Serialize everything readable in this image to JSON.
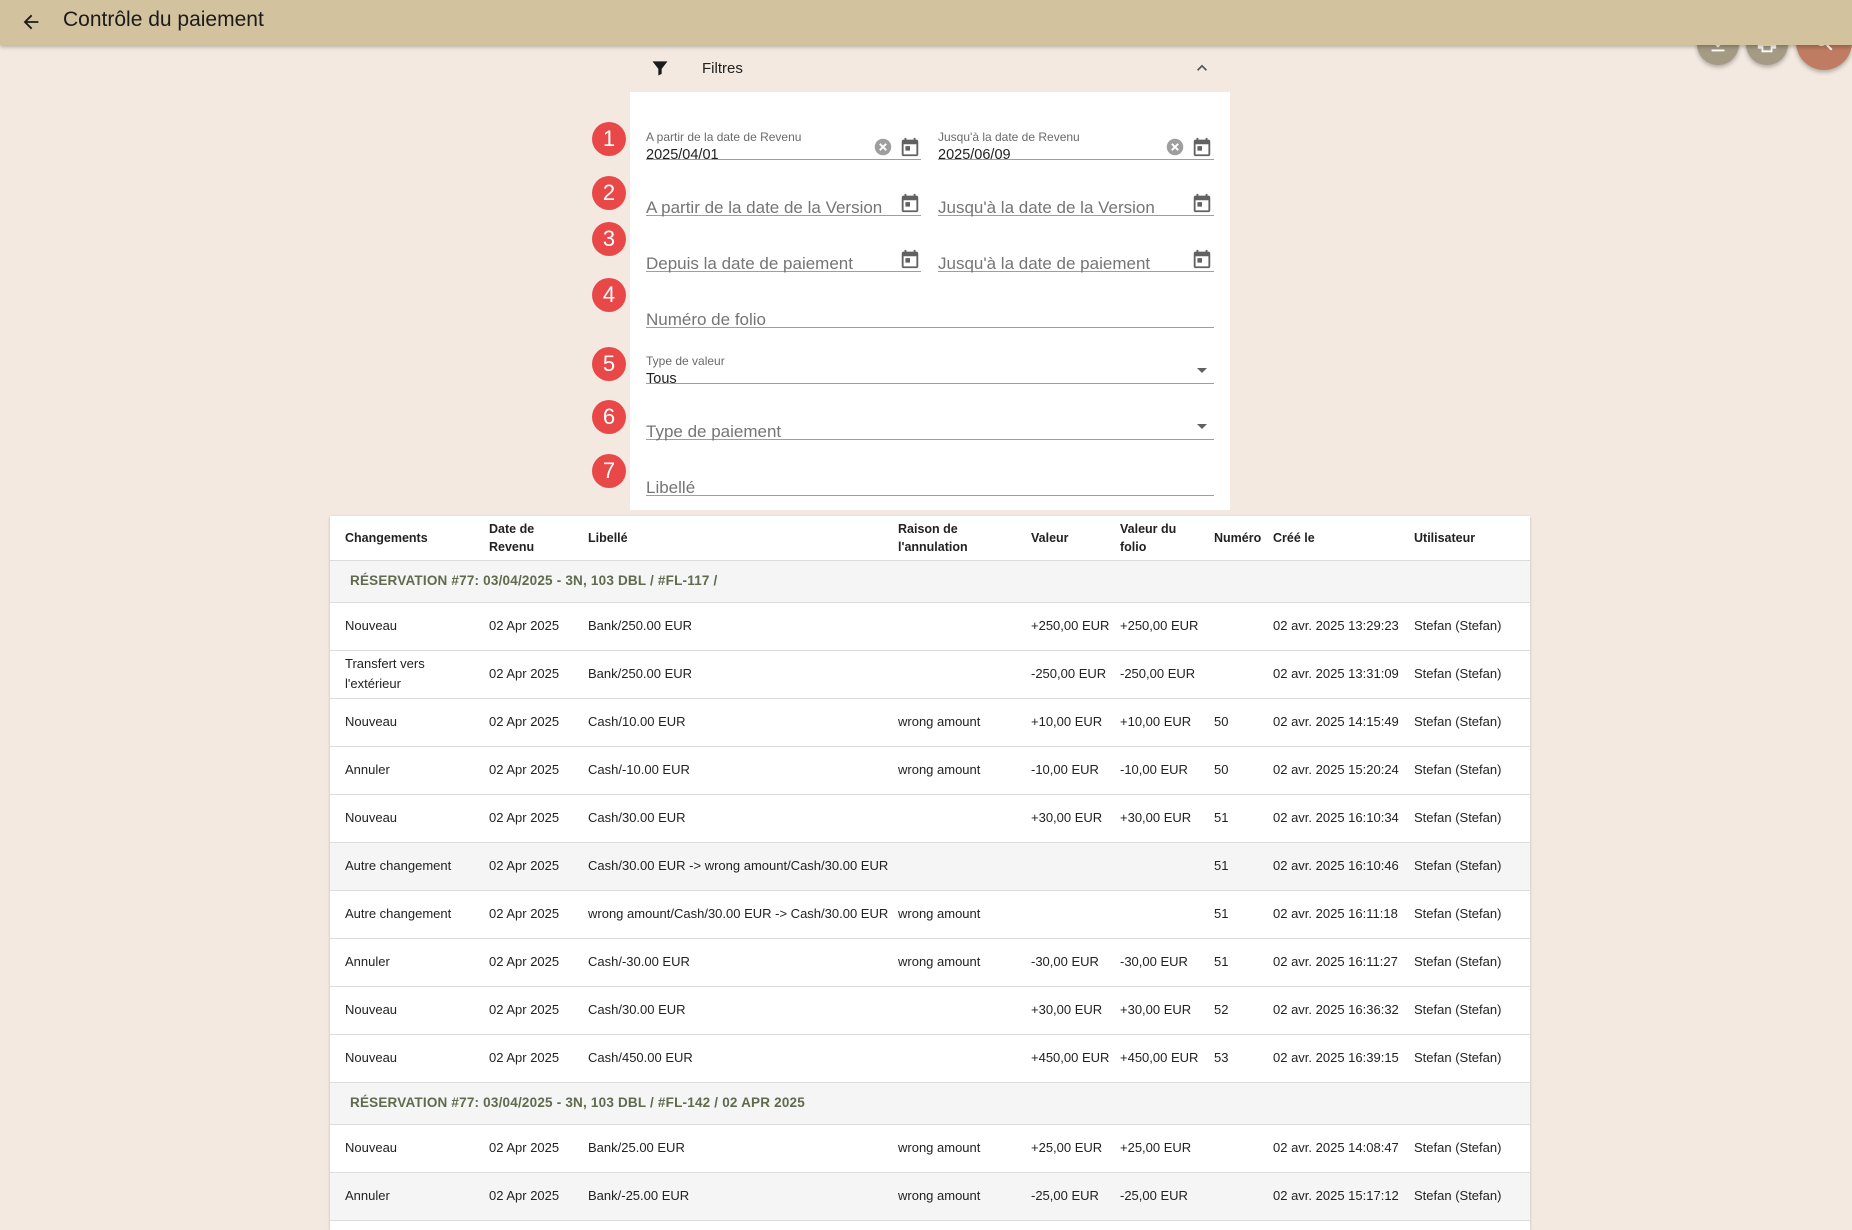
{
  "app": {
    "title": "Contrôle du paiement"
  },
  "filters": {
    "header_label": "Filtres",
    "revenue_from": {
      "label": "A partir de la date de Revenu",
      "value": "2025/04/01"
    },
    "revenue_to": {
      "label": "Jusqu'à la date de Revenu",
      "value": "2025/06/09"
    },
    "version_from_placeholder": "A partir de la date de la Version",
    "version_to_placeholder": "Jusqu'à la date de la Version",
    "payment_from_placeholder": "Depuis la date de paiement",
    "payment_to_placeholder": "Jusqu'à la date de paiement",
    "folio_placeholder": "Numéro de folio",
    "value_type": {
      "label": "Type de valeur",
      "value": "Tous"
    },
    "payment_type_placeholder": "Type de paiement",
    "libelle_placeholder": "Libellé"
  },
  "badges": [
    "1",
    "2",
    "3",
    "4",
    "5",
    "6",
    "7"
  ],
  "table": {
    "headers": {
      "changes": "Changements",
      "revenue_date_1": "Date de",
      "revenue_date_2": "Revenu",
      "libelle": "Libellé",
      "cancel_reason_1": "Raison de",
      "cancel_reason_2": "l'annulation",
      "value": "Valeur",
      "folio_value_1": "Valeur du",
      "folio_value_2": "folio",
      "number": "Numéro",
      "created": "Créé le",
      "user": "Utilisateur"
    },
    "rows": [
      {
        "type": "group",
        "text": "RÉSERVATION #77: 03/04/2025 - 3N, 103 DBL / #FL-117 /"
      },
      {
        "type": "row",
        "change": "Nouveau",
        "date": "02 Apr 2025",
        "libelle": "Bank/250.00 EUR",
        "reason": "",
        "value": "+250,00 EUR",
        "folio_value": "+250,00 EUR",
        "number": "",
        "created": "02 avr. 2025 13:29:23",
        "user": "Stefan (Stefan)",
        "shaded": false
      },
      {
        "type": "row",
        "change": "Transfert vers l'extérieur",
        "date": "02 Apr 2025",
        "libelle": "Bank/250.00 EUR",
        "reason": "",
        "value": "-250,00 EUR",
        "folio_value": "-250,00 EUR",
        "number": "",
        "created": "02 avr. 2025 13:31:09",
        "user": "Stefan (Stefan)",
        "shaded": false
      },
      {
        "type": "row",
        "change": "Nouveau",
        "date": "02 Apr 2025",
        "libelle": "Cash/10.00 EUR",
        "reason": "wrong amount",
        "value": "+10,00 EUR",
        "folio_value": "+10,00 EUR",
        "number": "50",
        "created": "02 avr. 2025 14:15:49",
        "user": "Stefan (Stefan)",
        "shaded": false
      },
      {
        "type": "row",
        "change": "Annuler",
        "date": "02 Apr 2025",
        "libelle": "Cash/-10.00 EUR",
        "reason": "wrong amount",
        "value": "-10,00 EUR",
        "folio_value": "-10,00 EUR",
        "number": "50",
        "created": "02 avr. 2025 15:20:24",
        "user": "Stefan (Stefan)",
        "shaded": false
      },
      {
        "type": "row",
        "change": "Nouveau",
        "date": "02 Apr 2025",
        "libelle": "Cash/30.00 EUR",
        "reason": "",
        "value": "+30,00 EUR",
        "folio_value": "+30,00 EUR",
        "number": "51",
        "created": "02 avr. 2025 16:10:34",
        "user": "Stefan (Stefan)",
        "shaded": false
      },
      {
        "type": "row",
        "change": "Autre changement",
        "date": "02 Apr 2025",
        "libelle": "Cash/30.00 EUR -> wrong amount/Cash/30.00 EUR",
        "reason": "",
        "value": "",
        "folio_value": "",
        "number": "51",
        "created": "02 avr. 2025 16:10:46",
        "user": "Stefan (Stefan)",
        "shaded": true
      },
      {
        "type": "row",
        "change": "Autre changement",
        "date": "02 Apr 2025",
        "libelle": "wrong amount/Cash/30.00 EUR -> Cash/30.00 EUR",
        "reason": "wrong amount",
        "value": "",
        "folio_value": "",
        "number": "51",
        "created": "02 avr. 2025 16:11:18",
        "user": "Stefan (Stefan)",
        "shaded": false
      },
      {
        "type": "row",
        "change": "Annuler",
        "date": "02 Apr 2025",
        "libelle": "Cash/-30.00 EUR",
        "reason": "wrong amount",
        "value": "-30,00 EUR",
        "folio_value": "-30,00 EUR",
        "number": "51",
        "created": "02 avr. 2025 16:11:27",
        "user": "Stefan (Stefan)",
        "shaded": false
      },
      {
        "type": "row",
        "change": "Nouveau",
        "date": "02 Apr 2025",
        "libelle": "Cash/30.00 EUR",
        "reason": "",
        "value": "+30,00 EUR",
        "folio_value": "+30,00 EUR",
        "number": "52",
        "created": "02 avr. 2025 16:36:32",
        "user": "Stefan (Stefan)",
        "shaded": false
      },
      {
        "type": "row",
        "change": "Nouveau",
        "date": "02 Apr 2025",
        "libelle": "Cash/450.00 EUR",
        "reason": "",
        "value": "+450,00 EUR",
        "folio_value": "+450,00 EUR",
        "number": "53",
        "created": "02 avr. 2025 16:39:15",
        "user": "Stefan (Stefan)",
        "shaded": false
      },
      {
        "type": "group",
        "text": "RÉSERVATION #77: 03/04/2025 - 3N, 103 DBL / #FL-142 / 02 APR 2025"
      },
      {
        "type": "row",
        "change": "Nouveau",
        "date": "02 Apr 2025",
        "libelle": "Bank/25.00 EUR",
        "reason": "wrong amount",
        "value": "+25,00 EUR",
        "folio_value": "+25,00 EUR",
        "number": "",
        "created": "02 avr. 2025 14:08:47",
        "user": "Stefan (Stefan)",
        "shaded": false
      },
      {
        "type": "row",
        "change": "Annuler",
        "date": "02 Apr 2025",
        "libelle": "Bank/-25.00 EUR",
        "reason": "wrong amount",
        "value": "-25,00 EUR",
        "folio_value": "-25,00 EUR",
        "number": "",
        "created": "02 avr. 2025 15:17:12",
        "user": "Stefan (Stefan)",
        "shaded": true
      },
      {
        "type": "row",
        "change": "",
        "date": "",
        "libelle": "",
        "reason": "",
        "value": "",
        "folio_value": "",
        "number": "",
        "created": "",
        "user": "",
        "shaded": false
      }
    ]
  },
  "icons": {
    "back": "arrow-left-icon",
    "download": "download-icon",
    "print": "printer-icon",
    "search": "search-icon",
    "filter": "funnel-icon",
    "collapse": "chevron-up-icon",
    "calendar": "calendar-icon",
    "clear": "clear-circle-icon",
    "dropdown": "caret-down-icon"
  },
  "colors": {
    "appbar": "#d2c29e",
    "background": "#f3e9e0",
    "badge": "#e94848",
    "search_fab": "#c07c62",
    "small_fab": "#a59a84",
    "group_text": "#5f6b4c"
  }
}
